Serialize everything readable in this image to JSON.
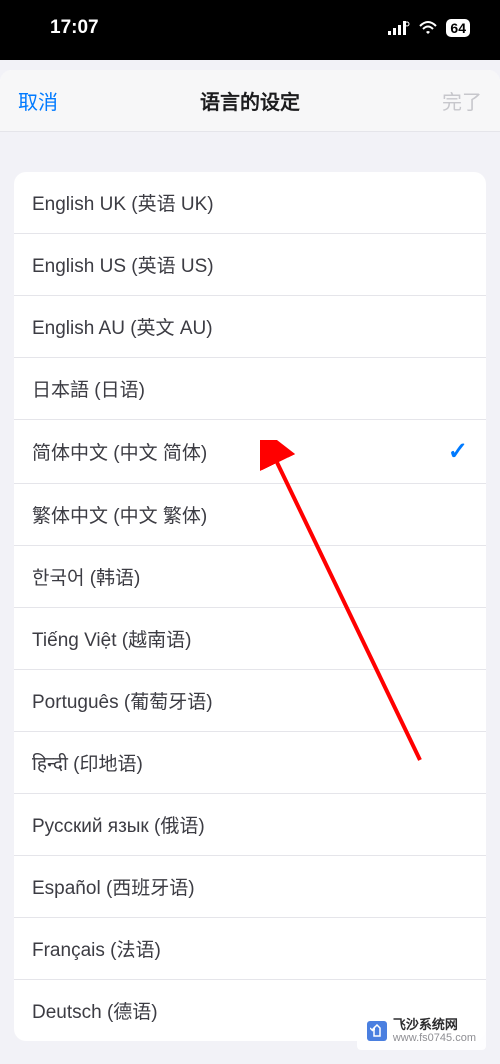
{
  "status_bar": {
    "time": "17:07",
    "battery": "64"
  },
  "nav": {
    "cancel": "取消",
    "title": "语言的设定",
    "done": "完了"
  },
  "languages": [
    {
      "label": "English UK (英语 UK)",
      "selected": false
    },
    {
      "label": "English US (英语 US)",
      "selected": false
    },
    {
      "label": "English AU (英文 AU)",
      "selected": false
    },
    {
      "label": "日本語 (日语)",
      "selected": false
    },
    {
      "label": "简体中文 (中文 简体)",
      "selected": true
    },
    {
      "label": "繁体中文 (中文 繁体)",
      "selected": false
    },
    {
      "label": "한국어 (韩语)",
      "selected": false
    },
    {
      "label": "Tiếng Việt (越南语)",
      "selected": false
    },
    {
      "label": "Português (葡萄牙语)",
      "selected": false
    },
    {
      "label": "हिन्दी (印地语)",
      "selected": false
    },
    {
      "label": "Русский язык (俄语)",
      "selected": false
    },
    {
      "label": "Español (西班牙语)",
      "selected": false
    },
    {
      "label": "Français (法语)",
      "selected": false
    },
    {
      "label": "Deutsch (德语)",
      "selected": false
    }
  ],
  "watermark": {
    "name": "飞沙系统网",
    "url": "www.fs0745.com"
  }
}
